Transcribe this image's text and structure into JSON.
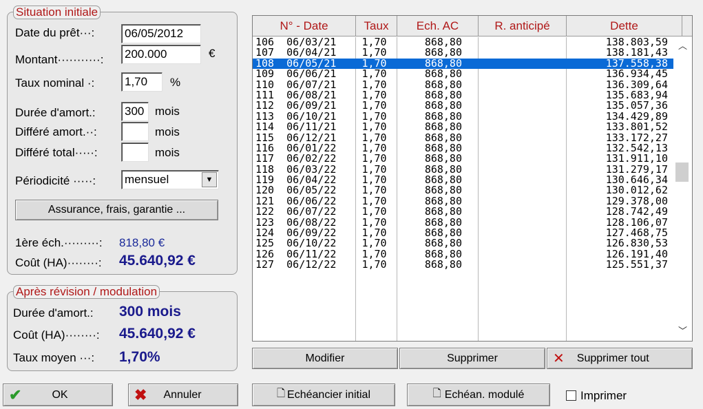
{
  "initial": {
    "title": "Situation initiale",
    "date_label": "Date du prêt···:",
    "date_value": "06/05/2012",
    "montant_label": "Montant···········:",
    "montant_value": "200.000",
    "currency": "€",
    "taux_label": "Taux nominal ·:",
    "taux_value": "1,70",
    "percent": "%",
    "duree_label": "Durée d'amort.:",
    "duree_value": "300",
    "mois": "mois",
    "differe_amort_label": "Différé amort.··:",
    "differe_amort_value": "",
    "differe_total_label": "Différé total·····:",
    "differe_total_value": "",
    "periodicite_label": "Périodicité ·····:",
    "periodicite_value": "mensuel",
    "assurance_button": "Assurance, frais, garantie ...",
    "premiere_ech_label": "1ère éch.·········:",
    "premiere_ech_value": "818,80 €",
    "cout_label": "Coût (HA)········:",
    "cout_value": "45.640,92 €"
  },
  "revision": {
    "title": "Après révision / modulation",
    "duree_label": "Durée d'amort.:",
    "duree_value": "300 mois",
    "cout_label": "Coût (HA)········:",
    "cout_value": "45.640,92 €",
    "taux_label": "Taux moyen ···:",
    "taux_value": "1,70%"
  },
  "table": {
    "headers": [
      "N° - Date",
      "Taux",
      "Ech. AC",
      "R. anticipé",
      "Dette"
    ],
    "selected_index": 2,
    "rows": [
      [
        "106  06/03/21",
        "1,70",
        "868,80",
        "",
        "138.803,59"
      ],
      [
        "107  06/04/21",
        "1,70",
        "868,80",
        "",
        "138.181,43"
      ],
      [
        "108  06/05/21",
        "1,70",
        "868,80",
        "",
        "137.558,38"
      ],
      [
        "109  06/06/21",
        "1,70",
        "868,80",
        "",
        "136.934,45"
      ],
      [
        "110  06/07/21",
        "1,70",
        "868,80",
        "",
        "136.309,64"
      ],
      [
        "111  06/08/21",
        "1,70",
        "868,80",
        "",
        "135.683,94"
      ],
      [
        "112  06/09/21",
        "1,70",
        "868,80",
        "",
        "135.057,36"
      ],
      [
        "113  06/10/21",
        "1,70",
        "868,80",
        "",
        "134.429,89"
      ],
      [
        "114  06/11/21",
        "1,70",
        "868,80",
        "",
        "133.801,52"
      ],
      [
        "115  06/12/21",
        "1,70",
        "868,80",
        "",
        "133.172,27"
      ],
      [
        "116  06/01/22",
        "1,70",
        "868,80",
        "",
        "132.542,13"
      ],
      [
        "117  06/02/22",
        "1,70",
        "868,80",
        "",
        "131.911,10"
      ],
      [
        "118  06/03/22",
        "1,70",
        "868,80",
        "",
        "131.279,17"
      ],
      [
        "119  06/04/22",
        "1,70",
        "868,80",
        "",
        "130.646,34"
      ],
      [
        "120  06/05/22",
        "1,70",
        "868,80",
        "",
        "130.012,62"
      ],
      [
        "121  06/06/22",
        "1,70",
        "868,80",
        "",
        "129.378,00"
      ],
      [
        "122  06/07/22",
        "1,70",
        "868,80",
        "",
        "128.742,49"
      ],
      [
        "123  06/08/22",
        "1,70",
        "868,80",
        "",
        "128.106,07"
      ],
      [
        "124  06/09/22",
        "1,70",
        "868,80",
        "",
        "127.468,75"
      ],
      [
        "125  06/10/22",
        "1,70",
        "868,80",
        "",
        "126.830,53"
      ],
      [
        "126  06/11/22",
        "1,70",
        "868,80",
        "",
        "126.191,40"
      ],
      [
        "127  06/12/22",
        "1,70",
        "868,80",
        "",
        "125.551,37"
      ]
    ]
  },
  "actions": {
    "modifier": "Modifier",
    "supprimer": "Supprimer",
    "supprimer_tout": "Supprimer tout",
    "ok": "OK",
    "annuler": "Annuler",
    "echeancier_initial": "Echéancier initial",
    "echeancier_module": "Echéan. modulé",
    "imprimer": "Imprimer"
  },
  "colors": {
    "accent_red": "#b01818",
    "value_blue": "#1a1a8c",
    "selection": "#0a6ad6",
    "ok_green": "#2a9a2a",
    "cancel_red": "#c01010"
  },
  "icons": {
    "ok": "checkmark-icon",
    "cancel": "x-icon",
    "delete_all": "x-icon",
    "preview": "magnifier-document-icon"
  }
}
